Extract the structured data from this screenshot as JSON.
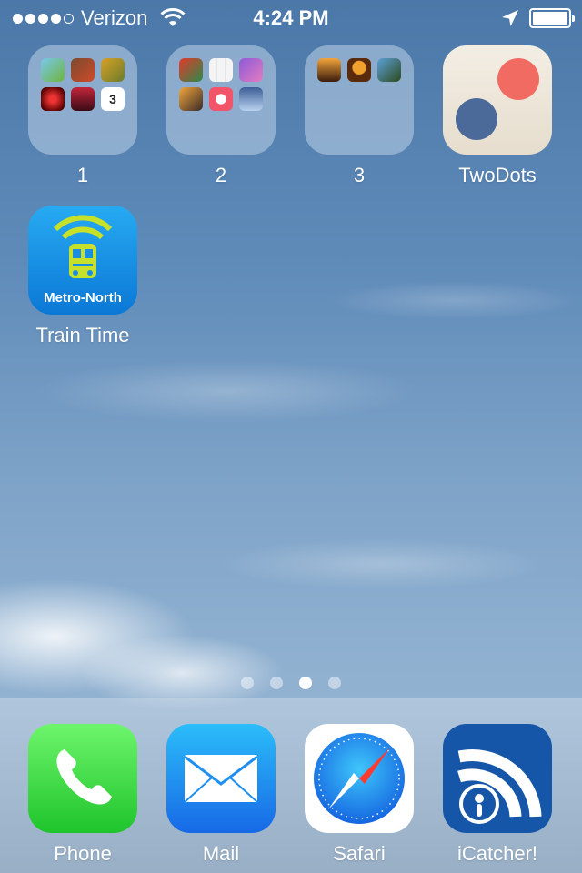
{
  "status_bar": {
    "carrier": "Verizon",
    "time": "4:24 PM",
    "signal_bars": 4,
    "signal_max": 5
  },
  "apps": [
    {
      "label": "1",
      "type": "folder"
    },
    {
      "label": "2",
      "type": "folder"
    },
    {
      "label": "3",
      "type": "folder"
    },
    {
      "label": "TwoDots",
      "type": "app"
    },
    {
      "label": "Train Time",
      "type": "app",
      "icon_text": "Metro-North"
    }
  ],
  "page_indicator": {
    "pages": 4,
    "current": 3
  },
  "dock": [
    {
      "label": "Phone"
    },
    {
      "label": "Mail"
    },
    {
      "label": "Safari"
    },
    {
      "label": "iCatcher!"
    }
  ],
  "colors": {
    "twodots_red": "#f26b63",
    "twodots_blue": "#4b6a9a",
    "phone_green": "#2ccd35",
    "mail_blue": "#1a8bf0",
    "icatcher_blue": "#1556a8"
  }
}
